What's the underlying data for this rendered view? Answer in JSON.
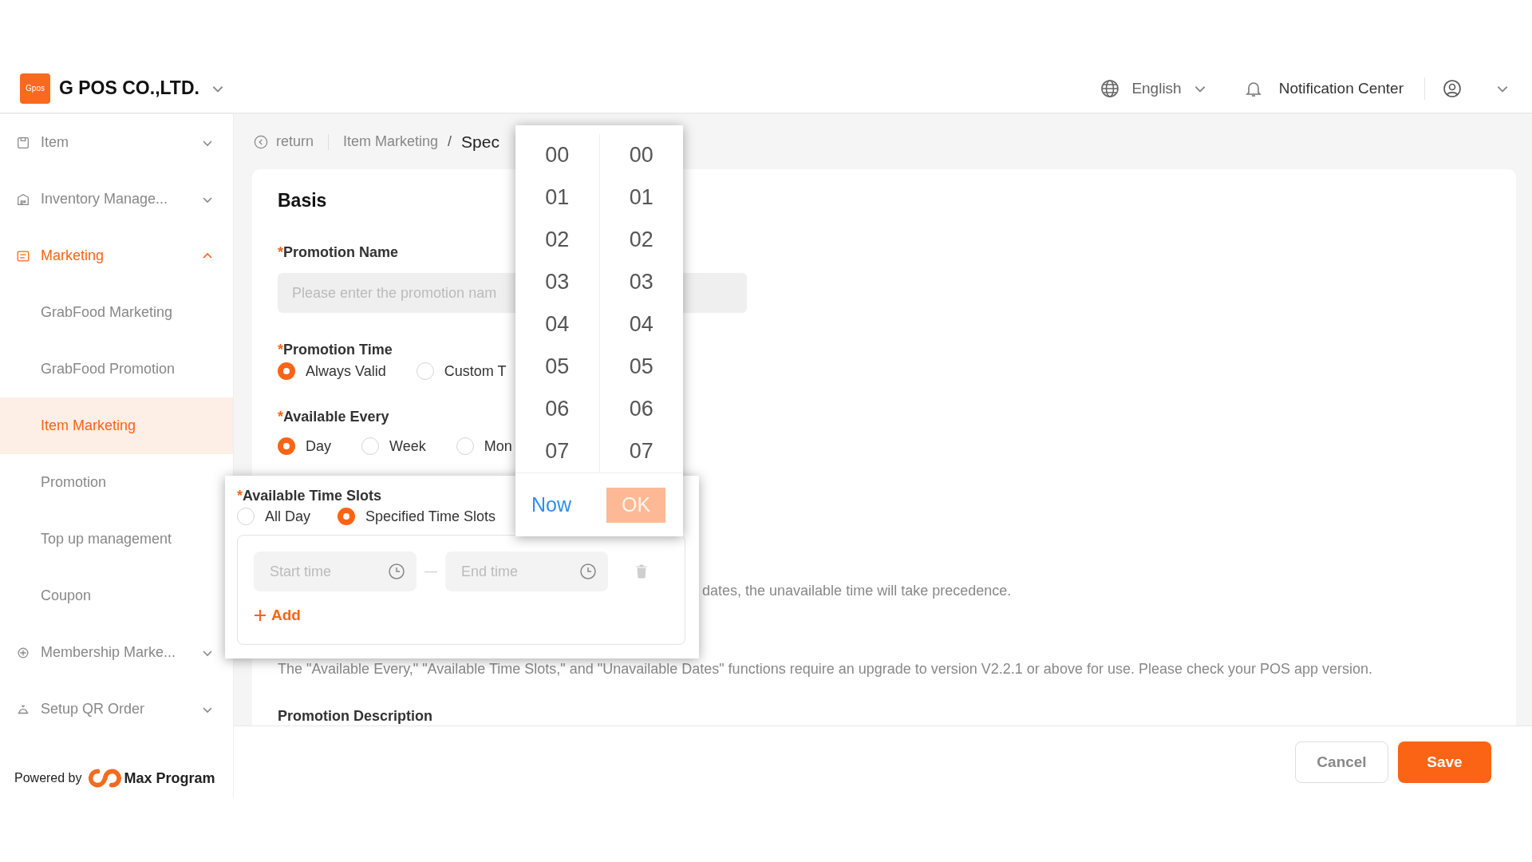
{
  "header": {
    "logo": "Gpos",
    "company": "G POS CO.,LTD.",
    "language": "English",
    "notifications": "Notification Center"
  },
  "sidebar": {
    "items": [
      {
        "label": "Item",
        "expanded": false
      },
      {
        "label": "Inventory Manage...",
        "expanded": false
      },
      {
        "label": "Marketing",
        "expanded": true,
        "children": [
          {
            "label": "GrabFood Marketing",
            "selected": false
          },
          {
            "label": "GrabFood Promotion",
            "selected": false
          },
          {
            "label": "Item Marketing",
            "selected": true
          },
          {
            "label": "Promotion",
            "selected": false
          },
          {
            "label": "Top up management",
            "selected": false
          },
          {
            "label": "Coupon",
            "selected": false
          }
        ]
      },
      {
        "label": "Membership Marke...",
        "expanded": false
      },
      {
        "label": "Setup QR Order",
        "expanded": false
      }
    ],
    "powered_by": "Powered by",
    "brand": "Max Program"
  },
  "breadcrumb": {
    "back": "return",
    "items": [
      "Item Marketing",
      "Spec"
    ],
    "separator": "/"
  },
  "form": {
    "section": "Basis",
    "promotion_name": {
      "mark": "*",
      "label": "Promotion Name",
      "placeholder": "Please enter the promotion nam"
    },
    "promotion_time": {
      "mark": "*",
      "label": "Promotion Time",
      "options": [
        {
          "label": "Always Valid",
          "selected": true
        },
        {
          "label": "Custom T",
          "selected": false
        }
      ]
    },
    "available_every": {
      "mark": "*",
      "label": "Available Every",
      "options": [
        {
          "label": "Day",
          "selected": true
        },
        {
          "label": "Week",
          "selected": false
        },
        {
          "label": "Mon",
          "selected": false
        }
      ]
    },
    "precedence_note": "dates, the unavailable time will take precedence.",
    "version_note": "The \"Available Every,\" \"Available Time Slots,\" and \"Unavailable Dates\" functions require an upgrade to version V2.2.1 or above for use. Please check your POS app version.",
    "description_label": "Promotion Description"
  },
  "time_slots_panel": {
    "mark": "*",
    "label": "Available Time Slots",
    "options": [
      {
        "label": "All Day",
        "selected": false
      },
      {
        "label": "Specified Time Slots",
        "selected": true
      }
    ],
    "start_placeholder": "Start time",
    "separator": "—",
    "end_placeholder": "End time",
    "add": "Add"
  },
  "time_picker": {
    "hours": [
      "00",
      "01",
      "02",
      "03",
      "04",
      "05",
      "06",
      "07"
    ],
    "minutes": [
      "00",
      "01",
      "02",
      "03",
      "04",
      "05",
      "06",
      "07"
    ],
    "now": "Now",
    "ok": {
      "label": "OK",
      "disabled": true
    }
  },
  "footer": {
    "cancel": "Cancel",
    "save": "Save"
  }
}
